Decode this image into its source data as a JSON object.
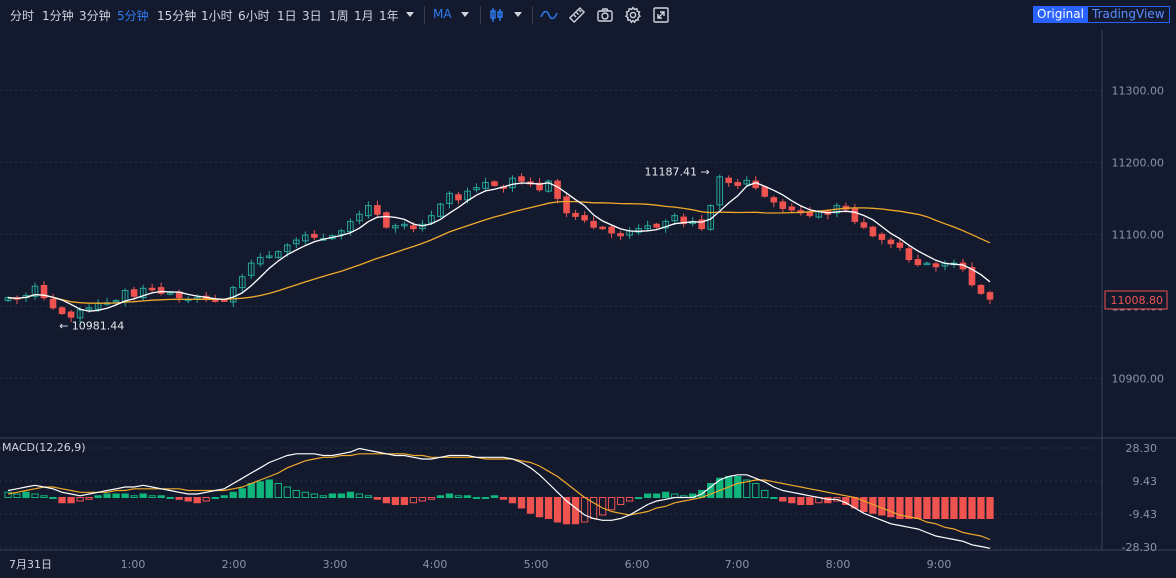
{
  "toolbar": {
    "intervals": [
      {
        "label": "分时",
        "active": false
      },
      {
        "label": "1分钟",
        "active": false
      },
      {
        "label": "3分钟",
        "active": false
      },
      {
        "label": "5分钟",
        "active": true
      },
      {
        "label": "15分钟",
        "active": false
      },
      {
        "label": "1小时",
        "active": false
      },
      {
        "label": "6小时",
        "active": false
      },
      {
        "label": "1日",
        "active": false
      },
      {
        "label": "3日",
        "active": false
      },
      {
        "label": "1周",
        "active": false
      },
      {
        "label": "1月",
        "active": false
      },
      {
        "label": "1年",
        "active": false
      }
    ],
    "indicator_label": "MA",
    "icons": [
      "candles-icon",
      "line-style-icon",
      "ruler-icon",
      "camera-icon",
      "gear-icon",
      "fullscreen-icon"
    ],
    "view_original": "Original",
    "view_tradingview": "TradingView"
  },
  "colors": {
    "background": "#131a2e",
    "up": "#26a69a",
    "up_fill": "#0fb57a",
    "down": "#ef5350",
    "ma_fast": "#ffffff",
    "ma_slow": "#f0a92a",
    "accent": "#2f7bf2",
    "grid": "#2a3147"
  },
  "chart_data": [
    {
      "type": "candlestick",
      "price_axis": [
        "11300.00",
        "11200.00",
        "11100.00",
        "11000.00",
        "10900.00"
      ],
      "price_axis_values": [
        11300,
        11200,
        11100,
        11000,
        10900
      ],
      "ylim": [
        10817,
        11384
      ],
      "last_price_label": "11008.80",
      "last_price": 11008.8,
      "high_annotation": "11187.41",
      "high_value": 11187.41,
      "low_annotation": "10981.44",
      "low_value": 10981.44,
      "close_series": [
        11012,
        11010,
        11015,
        11028,
        11012,
        10998,
        10990,
        10985,
        10995,
        10998,
        11004,
        11005,
        11008,
        11022,
        11014,
        11025,
        11024,
        11018,
        11019,
        11012,
        11010,
        11012,
        11010,
        11008,
        11008,
        11026,
        11041,
        11060,
        11068,
        11070,
        11076,
        11085,
        11092,
        11099,
        11096,
        11094,
        11098,
        11105,
        11118,
        11128,
        11140,
        11128,
        11110,
        11112,
        11114,
        11108,
        11114,
        11126,
        11142,
        11157,
        11148,
        11160,
        11165,
        11172,
        11168,
        11165,
        11178,
        11174,
        11170,
        11162,
        11174,
        11150,
        11130,
        11125,
        11120,
        11110,
        11108,
        11102,
        11098,
        11105,
        11108,
        11112,
        11110,
        11118,
        11126,
        11115,
        11118,
        11108,
        11140,
        11180,
        11172,
        11168,
        11175,
        11165,
        11153,
        11145,
        11136,
        11134,
        11130,
        11126,
        11132,
        11128,
        11140,
        11135,
        11118,
        11110,
        11098,
        11093,
        11087,
        11082,
        11065,
        11058,
        11060,
        11055,
        11060,
        11060,
        11052,
        11030,
        11018,
        11010
      ],
      "ma_fast_label": "MA (white)",
      "ma_slow_label": "MA (orange)"
    },
    {
      "type": "macd",
      "title": "MACD(12,26,9)",
      "axis_labels": [
        "28.30",
        "9.43",
        "-9.43",
        "-28.30"
      ],
      "axis_values": [
        28.3,
        9.43,
        -9.43,
        -28.3
      ],
      "ylim": [
        -30,
        34
      ],
      "x_ticks": [
        "7月31日",
        "1:00",
        "2:00",
        "3:00",
        "4:00",
        "5:00",
        "6:00",
        "7:00",
        "8:00",
        "9:00"
      ],
      "histogram": [
        3,
        2,
        3,
        2,
        1,
        0,
        -3,
        -3,
        -2,
        -1,
        1,
        2,
        2,
        2,
        1,
        2,
        1,
        1,
        0,
        -1,
        -2,
        -3,
        -2,
        0,
        1,
        3,
        5,
        8,
        9,
        10,
        8,
        6,
        4,
        3,
        2,
        1,
        2,
        2,
        3,
        2,
        1,
        -1,
        -3,
        -4,
        -4,
        -3,
        -2,
        -1,
        1,
        2,
        1,
        1,
        0,
        0,
        1,
        -1,
        -3,
        -6,
        -9,
        -11,
        -12,
        -14,
        -15,
        -15,
        -14,
        -12,
        -10,
        -7,
        -4,
        -2,
        0,
        2,
        2,
        3,
        2,
        1,
        2,
        4,
        8,
        11,
        12,
        12,
        10,
        8,
        4,
        0,
        -2,
        -3,
        -4,
        -4,
        -3,
        -3,
        -2,
        -4,
        -6,
        -8,
        -9,
        -10,
        -11,
        -12,
        -12,
        -12,
        -12,
        -12,
        -12,
        -12,
        -12,
        -12,
        -12,
        -12
      ],
      "macd_line": [
        4,
        5,
        6,
        7,
        6,
        5,
        3,
        2,
        1,
        2,
        3,
        4,
        5,
        6,
        6,
        7,
        6,
        5,
        4,
        3,
        2,
        2,
        3,
        4,
        5,
        8,
        11,
        14,
        17,
        20,
        22,
        24,
        25,
        25,
        25,
        24,
        24,
        25,
        26,
        28,
        27,
        26,
        25,
        24,
        24,
        23,
        22,
        22,
        23,
        24,
        24,
        24,
        23,
        23,
        23,
        23,
        22,
        20,
        17,
        13,
        8,
        3,
        -2,
        -6,
        -10,
        -12,
        -13,
        -13,
        -12,
        -10,
        -7,
        -4,
        -2,
        -1,
        0,
        0,
        0,
        2,
        6,
        10,
        12,
        13,
        13,
        11,
        9,
        6,
        4,
        3,
        2,
        1,
        0,
        -1,
        -1,
        -3,
        -6,
        -9,
        -11,
        -13,
        -15,
        -16,
        -17,
        -18,
        -20,
        -22,
        -23,
        -24,
        -25,
        -27,
        -28,
        -29
      ],
      "signal_line": [
        2,
        3,
        4,
        5,
        6,
        6,
        5,
        4,
        3,
        3,
        3,
        3,
        4,
        4,
        5,
        5,
        5,
        5,
        5,
        5,
        4,
        4,
        4,
        4,
        4,
        5,
        6,
        8,
        10,
        12,
        14,
        17,
        19,
        21,
        22,
        23,
        23,
        24,
        24,
        25,
        25,
        25,
        25,
        25,
        25,
        24,
        24,
        23,
        23,
        23,
        23,
        23,
        23,
        22,
        22,
        22,
        22,
        21,
        20,
        18,
        15,
        12,
        8,
        4,
        0,
        -3,
        -6,
        -8,
        -9,
        -10,
        -9,
        -8,
        -6,
        -5,
        -3,
        -2,
        -1,
        0,
        2,
        4,
        6,
        8,
        9,
        10,
        10,
        9,
        8,
        7,
        6,
        5,
        4,
        3,
        2,
        1,
        0,
        -2,
        -4,
        -6,
        -8,
        -10,
        -11,
        -12,
        -14,
        -15,
        -17,
        -18,
        -20,
        -21,
        -22,
        -24
      ]
    }
  ]
}
